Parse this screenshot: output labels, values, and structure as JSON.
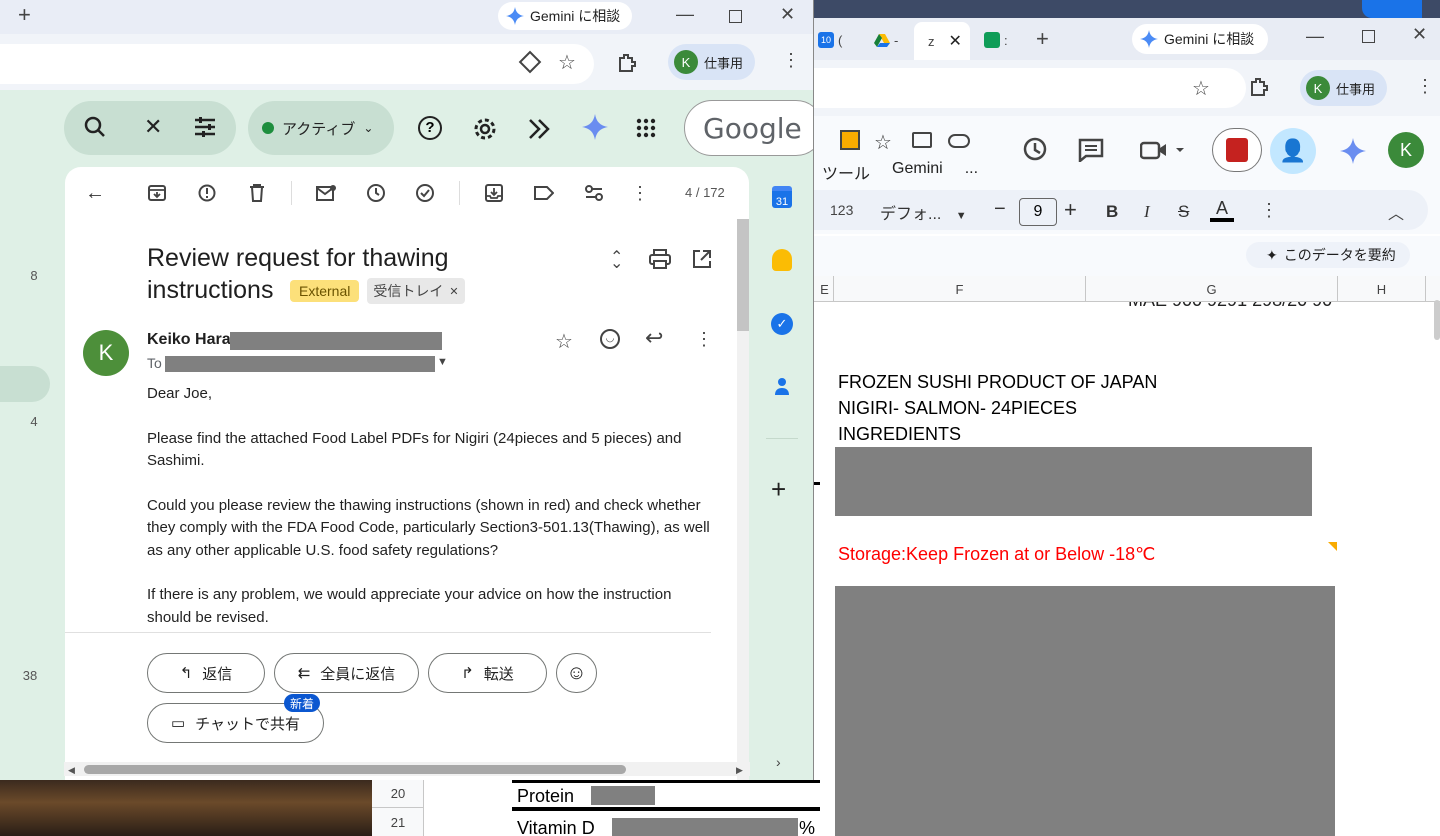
{
  "right_window": {
    "tabs": [
      {
        "label": "(",
        "icon": "calendar-icon"
      },
      {
        "label": "-",
        "icon": "drive-icon"
      },
      {
        "label": "z",
        "icon": "close-icon"
      },
      {
        "label": ":",
        "icon": "meet-icon"
      }
    ],
    "new_tab": "+",
    "gemini_button": "Gemini に相談",
    "profile_label": "仕事用",
    "profile_initial": "K",
    "app_toolbar": {
      "tools_label": "ツール",
      "gemini_label": "Gemini",
      "more_label": "..."
    },
    "user_initial": "K",
    "format_toolbar": {
      "number_format": "123",
      "font": "デフォ...",
      "font_size": "9",
      "minus": "−",
      "plus": "+",
      "bold": "B",
      "italic": "I",
      "strike": "S",
      "text_color": "A"
    },
    "summarize_button": "このデータを要約",
    "columns": [
      "E",
      "F",
      "G",
      "H"
    ],
    "cells": {
      "top_partial": "MAE 900 9291 298/20 90",
      "line1": "FROZEN SUSHI  PRODUCT OF JAPAN",
      "line2": "NIGIRI- SALMON- 24PIECES",
      "line3": "INGREDIENTS",
      "storage": "Storage:Keep Frozen at or  Below -18℃"
    },
    "colors": {
      "storage_text": "#ff0000",
      "accent": "#1a73e8"
    }
  },
  "background_sheet": {
    "rows": [
      {
        "num": "20",
        "label": "Protein",
        "suffix": ""
      },
      {
        "num": "21",
        "label": "Vitamin D",
        "suffix": "%"
      }
    ]
  },
  "left_window": {
    "new_tab": "+",
    "gemini_button": "Gemini に相談",
    "profile_label": "仕事用",
    "profile_initial": "K",
    "gmail_bar": {
      "status": "アクティブ",
      "google_logo": "Google"
    },
    "left_numbers": [
      "8",
      "4",
      "38"
    ],
    "toolbar": {
      "pager": "4 / 172"
    },
    "email": {
      "subject": "Review request for thawing instructions",
      "label_external": "External",
      "label_inbox": "受信トレイ",
      "sender_name": "Keiko Hara",
      "sender_initial": "K",
      "to_label": "To",
      "greeting": "Dear Joe,",
      "para1": "Please  find the attached Food Label PDFs for Nigiri (24pieces and 5 pieces) and Sashimi.",
      "para2": "Could you please review the thawing instructions (shown in red) and check whether they comply with the FDA Food Code, particularly Section3-501.13(Thawing), as well as any other applicable U.S. food safety regulations?",
      "para3": "If there is any problem, we would appreciate your advice on how the instruction should be revised."
    },
    "actions": {
      "reply": "返信",
      "reply_all": "全員に返信",
      "forward": "転送",
      "share_chat": "チャットで共有",
      "new_badge": "新着"
    },
    "side_panel": {
      "calendar_day": "31"
    },
    "colors": {
      "background": "#dff0e6",
      "external_chip": "#fce07a",
      "badge": "#0b57d0"
    }
  }
}
